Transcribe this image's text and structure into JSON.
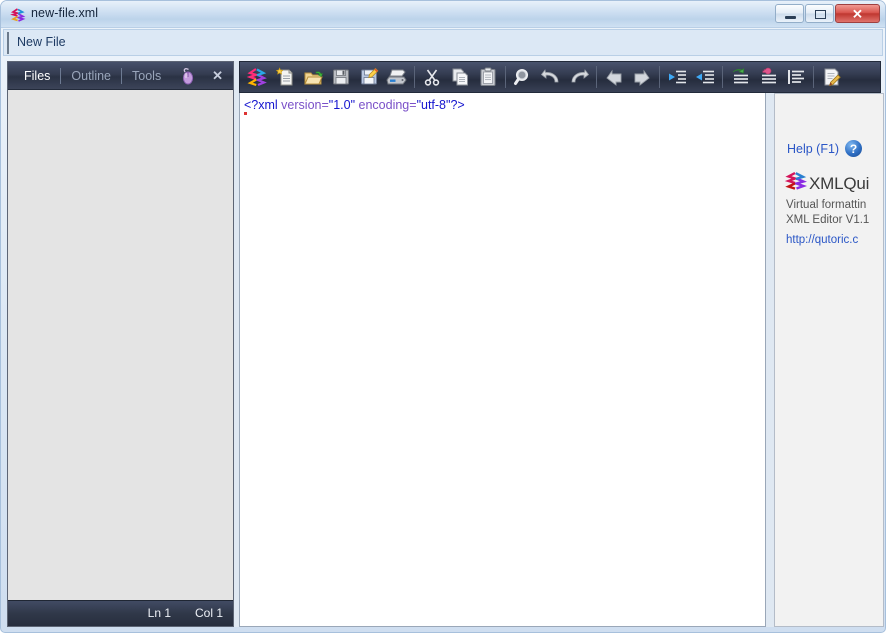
{
  "window": {
    "title": "new-file.xml",
    "icon": "xmlquire-logo-icon",
    "controls": {
      "minimize_label": "Minimize",
      "restore_label": "Restore",
      "close_label": "✕"
    }
  },
  "tabstrip": {
    "tabs": [
      {
        "label": "New File",
        "active": true
      }
    ]
  },
  "left_panel": {
    "tabs": [
      {
        "label": "Files",
        "active": true
      },
      {
        "label": "Outline",
        "active": false
      },
      {
        "label": "Tools",
        "active": false
      }
    ],
    "mouse_icon": "computer-mouse-icon",
    "close_label": "✕",
    "status": {
      "line": "Ln 1",
      "column": "Col 1"
    }
  },
  "toolbar": {
    "buttons": [
      {
        "name": "xmlquire-logo-icon",
        "label": "XMLQuire"
      },
      {
        "name": "new-file-icon",
        "label": "New File"
      },
      {
        "name": "open-folder-icon",
        "label": "Open"
      },
      {
        "name": "save-icon",
        "label": "Save"
      },
      {
        "name": "save-as-icon",
        "label": "Save As"
      },
      {
        "name": "print-icon",
        "label": "Print"
      },
      {
        "name": "cut-icon",
        "label": "Cut"
      },
      {
        "name": "copy-icon",
        "label": "Copy"
      },
      {
        "name": "paste-icon",
        "label": "Paste"
      },
      {
        "name": "find-icon",
        "label": "Find"
      },
      {
        "name": "undo-icon",
        "label": "Undo"
      },
      {
        "name": "redo-icon",
        "label": "Redo"
      },
      {
        "name": "back-icon",
        "label": "Back"
      },
      {
        "name": "forward-icon",
        "label": "Forward"
      },
      {
        "name": "outdent-icon",
        "label": "Outdent"
      },
      {
        "name": "indent-icon",
        "label": "Indent"
      },
      {
        "name": "insert-element-icon",
        "label": "Insert Element"
      },
      {
        "name": "insert-attribute-icon",
        "label": "Insert Attribute"
      },
      {
        "name": "format-list-icon",
        "label": "Format"
      },
      {
        "name": "edit-document-icon",
        "label": "Edit"
      }
    ]
  },
  "editor": {
    "code": {
      "declaration_open": "<?xml",
      "attr_version": " version=",
      "val_version": "\"1.0\"",
      "attr_encoding": " encoding=",
      "val_encoding": "\"utf-8\"",
      "declaration_close": "?>"
    }
  },
  "help_panel": {
    "help_link": "Help (F1)",
    "help_icon": "question-mark-icon",
    "logo_icon": "xmlquire-logo-icon",
    "brand": "XMLQui",
    "description_line1": "Virtual formattin",
    "description_line2": "XML Editor V1.1",
    "url": "http://qutoric.c"
  },
  "colors": {
    "toolbar_dark": "#2a3244",
    "panel_dark": "#343c51",
    "accent_blue": "#2a56c6",
    "syntax_blue": "#1515cf",
    "syntax_purple": "#7a50c8",
    "close_red": "#bf3730"
  }
}
